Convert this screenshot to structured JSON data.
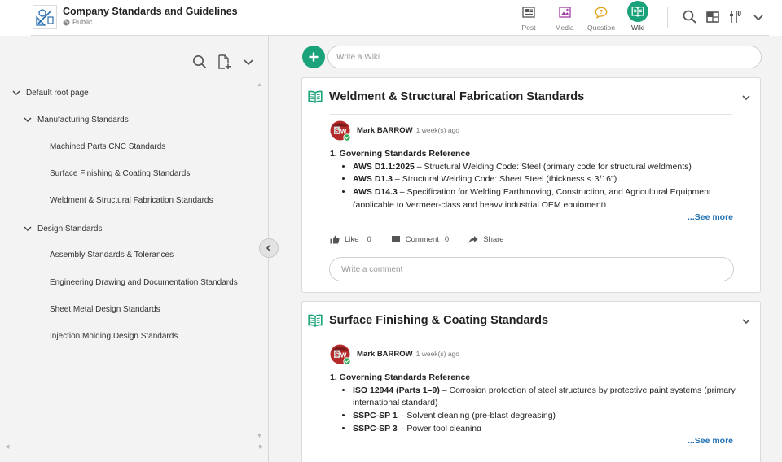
{
  "header": {
    "title": "Company Standards and Guidelines",
    "visibility": "Public",
    "nav": [
      {
        "label": "Post",
        "icon": "post-icon"
      },
      {
        "label": "Media",
        "icon": "media-icon"
      },
      {
        "label": "Question",
        "icon": "question-icon"
      },
      {
        "label": "Wiki",
        "icon": "wiki-icon",
        "active": true
      }
    ],
    "colors": {
      "accent": "#1aa37a",
      "media": "#a33ca3",
      "question": "#e0a21a",
      "link": "#1f6fb2"
    }
  },
  "sidebar": {
    "tree": [
      {
        "label": "Default root page",
        "level": 0,
        "expanded": true
      },
      {
        "label": "Manufacturing Standards",
        "level": 1,
        "expanded": true
      },
      {
        "label": "Machined Parts CNC Standards",
        "level": 2
      },
      {
        "label": "Surface Finishing & Coating Standards",
        "level": 2
      },
      {
        "label": "Weldment & Structural Fabrication Standards",
        "level": 2
      },
      {
        "label": "Design Standards",
        "level": 1,
        "expanded": true
      },
      {
        "label": "Assembly Standards & Tolerances",
        "level": 2
      },
      {
        "label": "Engineering Drawing and Documentation Standards",
        "level": 2
      },
      {
        "label": "Sheet Metal Design Standards",
        "level": 2
      },
      {
        "label": "Injection Molding Design Standards",
        "level": 2
      }
    ]
  },
  "main": {
    "wiki_placeholder": "Write a Wiki",
    "cards": [
      {
        "title": "Weldment & Structural Fabrication Standards",
        "author": "Mark BARROW",
        "time": "1 week(s) ago",
        "heading": "1. Governing Standards Reference",
        "items": [
          {
            "code": "AWS D1.1:2025",
            "text": " – Structural Welding Code: Steel (primary code for structural weldments)"
          },
          {
            "code": "AWS D1.3",
            "text": " – Structural Welding Code: Sheet Steel (thickness < 3/16\")"
          },
          {
            "code": "AWS D14.3",
            "text": " – Specification for Welding Earthmoving, Construction, and Agricultural Equipment (applicable to Vermeer-class and heavy industrial OEM equipment)"
          }
        ],
        "see_more": "...See more",
        "like_label": "Like",
        "like_count": "0",
        "comment_label": "Comment",
        "comment_count": "0",
        "share_label": "Share",
        "comment_placeholder": "Write a comment"
      },
      {
        "title": "Surface Finishing & Coating Standards",
        "author": "Mark BARROW",
        "time": "1 week(s) ago",
        "heading": "1. Governing Standards Reference",
        "items": [
          {
            "code": "ISO 12944 (Parts 1–9)",
            "text": " – Corrosion protection of steel structures by protective paint systems (primary international standard)"
          },
          {
            "code": "SSPC-SP 1",
            "text": " – Solvent cleaning (pre-blast degreasing)"
          },
          {
            "code": "SSPC-SP 3",
            "text": " – Power tool cleaning"
          }
        ],
        "see_more": "...See more"
      }
    ]
  }
}
